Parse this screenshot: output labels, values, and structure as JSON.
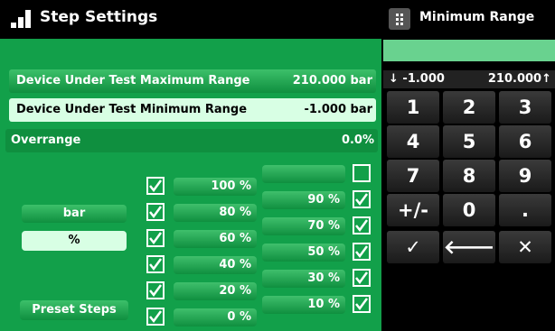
{
  "left_header": {
    "title": "Step Settings"
  },
  "right_header": {
    "title": "Minimum Range"
  },
  "rows": [
    {
      "label": "Device Under Test Maximum Range",
      "value": "210.000 bar"
    },
    {
      "label": "Device Under Test Minimum Range",
      "value": "-1.000 bar"
    },
    {
      "label": "Overrange",
      "value": "0.0%"
    }
  ],
  "units": {
    "bar": "bar",
    "percent": "%"
  },
  "preset_label": "Preset Steps",
  "steps_left": [
    "100 %",
    "80 %",
    "60 %",
    "40 %",
    "20 %",
    "0 %"
  ],
  "steps_right": [
    "",
    "90 %",
    "70 %",
    "50 %",
    "30 %",
    "10 %"
  ],
  "checks_left": [
    true,
    true,
    true,
    true,
    true,
    true
  ],
  "checks_right": [
    false,
    true,
    true,
    true,
    true,
    true
  ],
  "range": {
    "min": "-1.000",
    "max": "210.000"
  },
  "keys": [
    "1",
    "2",
    "3",
    "4",
    "5",
    "6",
    "7",
    "8",
    "9",
    "+/-",
    "0",
    "."
  ],
  "action_keys": {
    "ok": "✓",
    "back": "🡐",
    "cancel": "✕"
  },
  "colors": {
    "panel_green": "#12a04a",
    "selected_row": "#d8ffe4",
    "accent": "#69d28f"
  }
}
